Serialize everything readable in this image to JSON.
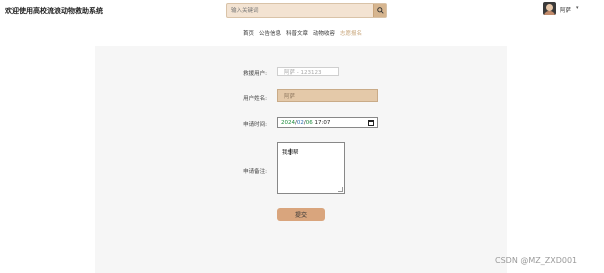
{
  "header": {
    "site_title": "欢迎使用高校流浪动物救助系统",
    "search_placeholder": "输入关键词",
    "user_name": "阿萨",
    "user_caret": "▾"
  },
  "nav": {
    "items": [
      {
        "label": "首页",
        "active": false
      },
      {
        "label": "公告信息",
        "active": false
      },
      {
        "label": "科普文章",
        "active": false
      },
      {
        "label": "动物收容",
        "active": false
      },
      {
        "label": "志愿报名",
        "active": true
      }
    ]
  },
  "form": {
    "applicant_user_label": "救援用户:",
    "applicant_user_value": "阿萨 - 123123",
    "user_name_label": "用户姓名:",
    "user_name_value": "阿萨",
    "apply_time_label": "申请时间:",
    "apply_time_year": "2024",
    "apply_time_month": "02",
    "apply_time_day": "06",
    "apply_time_clock": "17:07",
    "apply_note_label": "申请备注:",
    "apply_note_value": "我想帮",
    "submit_label": "提交"
  },
  "watermark": "CSDN @MZ_ZXD001",
  "colors": {
    "accent": "#d9a57d",
    "nav_active": "#c9a77c",
    "panel_bg": "#f6f6f6"
  }
}
